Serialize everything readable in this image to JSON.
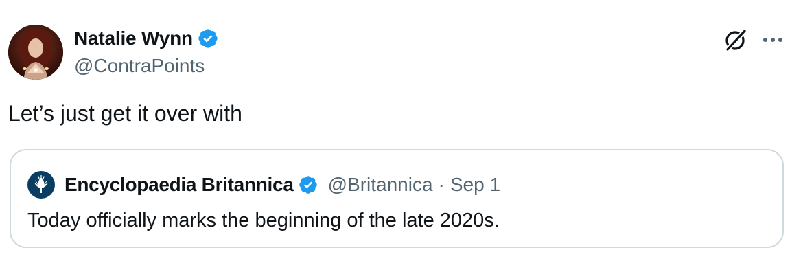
{
  "post": {
    "author_name": "Natalie Wynn",
    "author_handle": "@ContraPoints",
    "text": "Let’s just get it over with"
  },
  "quoted_post": {
    "author_name": "Encyclopaedia Britannica",
    "author_handle": "@Britannica",
    "separator": "·",
    "date": "Sep 1",
    "text": "Today officially marks the beginning of the late 2020s."
  },
  "icons": {
    "verified_badge": "verified-badge-icon",
    "grok": "grok-icon",
    "more": "more-options-icon",
    "britannica_logo": "thistle-logo-icon"
  },
  "colors": {
    "verified_blue": "#1d9bf0",
    "text_primary": "#0f1419",
    "text_secondary": "#536471",
    "border": "#cfd9de",
    "britannica_navy": "#0a3d62"
  }
}
